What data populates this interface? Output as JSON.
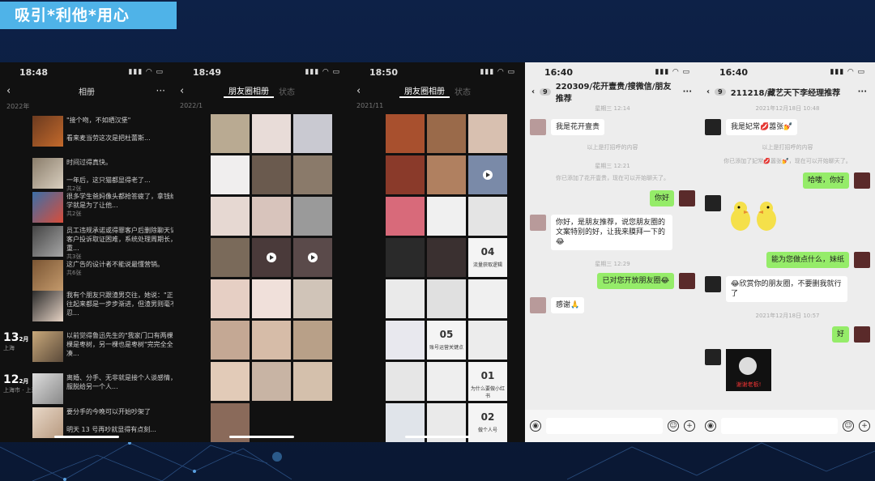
{
  "slide": {
    "title": "吸引*利他*用心"
  },
  "phone1": {
    "time": "18:48",
    "title": "相册",
    "year": "2022年",
    "moments": [
      {
        "text": "\"接个吻，不如晒汉堡\"",
        "sub": ""
      },
      {
        "text": "看来麦当劳这次是把杜蕾斯...",
        "sub": ""
      },
      {
        "text": "时间过得真快。",
        "sub": ""
      },
      {
        "text": "一年后，这只猫都显得老了...",
        "sub": "共2张"
      },
      {
        "text": "很多学生爸妈像头都抢答疲了，拿钱给他上学就是为了让他...",
        "sub": "共2张"
      },
      {
        "text": "员工违规承诺或得罪客户后删除聊天记录，客户投诉取证困难，系统处理周期长，严重...",
        "sub": "共3张"
      },
      {
        "text": "这广告的设计者不能说最懂营销。",
        "sub": "共6张"
      },
      {
        "text": "我有个朋友只跟渣男交往，她说：\"正经人交往起来都是一步步渐进，但渣男则毫不隐忍...",
        "sub": ""
      },
      {
        "text": "以前觉得鲁迅先生的\"我家门口有两棵树，一棵是枣树，另一棵也是枣树\"完完全全是在凑...",
        "sub": ""
      },
      {
        "text": "离婚、分手、无非就是接个人谈感情，把衣服脱给另一个人...",
        "sub": ""
      },
      {
        "text": "要分手的今晚可以开始吵架了",
        "sub": ""
      },
      {
        "text": "明天 13 号再吵就显得有点刻...",
        "sub": ""
      }
    ],
    "dates": [
      {
        "day": "13",
        "month": "2月",
        "loc": "上海"
      },
      {
        "day": "12",
        "month": "2月",
        "loc": "上海市 · 上海陆家..."
      }
    ]
  },
  "phone2": {
    "time": "18:49",
    "tab_active": "朋友圈相册",
    "tab_inactive": "状态",
    "year": "2022/1"
  },
  "phone3": {
    "time": "18:50",
    "tab_active": "朋友圈相册",
    "tab_inactive": "状态",
    "year": "2021/11",
    "docs": [
      {
        "num": "04",
        "text": "流量获取逻辑"
      },
      {
        "num": "05",
        "text": "账号运营关键点"
      },
      {
        "num": "01",
        "text": "为什么要做小红书"
      },
      {
        "num": "02",
        "text": "做个人号"
      }
    ]
  },
  "phone4": {
    "time": "16:40",
    "badge": "9",
    "title": "220309/花开壹贵/搜微信/朋友推荐",
    "ts1": "星期三 12:14",
    "m1": "我是花开壹贵",
    "sys1": "以上是打招呼的内容",
    "ts2": "星期三 12:21",
    "sys2": "你已添加了花开壹贵，现在可以开始聊天了。",
    "m2": "你好",
    "m3": "你好，是朋友推荐，说您朋友圈的文案特别的好，让我来膜拜一下的😂",
    "ts3": "星期三 12:29",
    "m4": "已对您开放朋友圈😂",
    "m5": "感谢🙏"
  },
  "phone5": {
    "time": "16:40",
    "badge": "9",
    "title": "211218/藏艺天下李经理推荐",
    "ts1": "2021年12月18日 10:48",
    "m1": "我是妃常💋嚣张💅",
    "sys1": "以上是打招呼的内容",
    "sys2": "你已添加了妃常💋嚣张💅，现在可以开始聊天了。",
    "m2": "哈喽，你好",
    "m3": "能为您做点什么，妹纸",
    "m4": "😂欣赏你的朋友圈，不要删我就行了",
    "ts2": "2021年12月18日 10:57",
    "m5": "好",
    "img_caption": "谢谢老板!"
  },
  "colors": {
    "accent": "#4fb3e8",
    "bubble_green": "#95ec69"
  }
}
